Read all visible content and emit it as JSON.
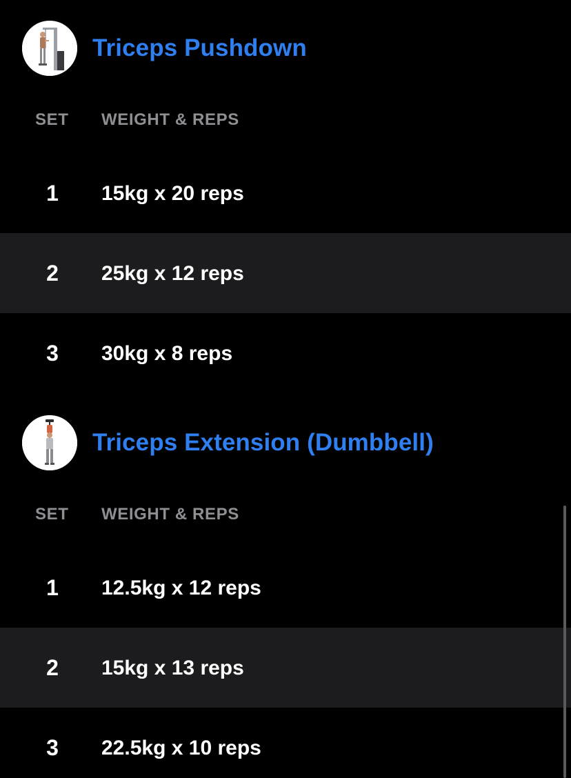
{
  "columns": {
    "set_label": "SET",
    "weight_reps_label": "WEIGHT & REPS"
  },
  "exercises": [
    {
      "title": "Triceps Pushdown",
      "icon": "cable-pushdown-figure-icon",
      "sets": [
        {
          "set": "1",
          "value": "15kg x 20 reps"
        },
        {
          "set": "2",
          "value": "25kg x 12 reps"
        },
        {
          "set": "3",
          "value": "30kg x 8 reps"
        }
      ]
    },
    {
      "title": "Triceps Extension (Dumbbell)",
      "icon": "dumbbell-overhead-figure-icon",
      "sets": [
        {
          "set": "1",
          "value": "12.5kg x 12 reps"
        },
        {
          "set": "2",
          "value": "15kg x 13 reps"
        },
        {
          "set": "3",
          "value": "22.5kg x 10 reps"
        }
      ]
    }
  ],
  "colors": {
    "background": "#000000",
    "row_alt": "#1c1c1e",
    "title_accent": "#2f7ff0",
    "column_header": "#8e8e93",
    "text": "#ffffff"
  }
}
